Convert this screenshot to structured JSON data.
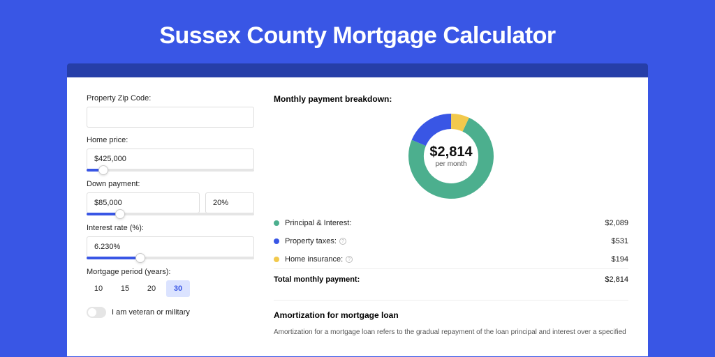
{
  "hero": {
    "title": "Sussex County Mortgage Calculator"
  },
  "form": {
    "zip": {
      "label": "Property Zip Code:",
      "value": ""
    },
    "home_price": {
      "label": "Home price:",
      "value": "$425,000",
      "slider_pct": 10
    },
    "down_payment": {
      "label": "Down payment:",
      "value": "$85,000",
      "pct": "20%",
      "slider_pct": 20
    },
    "interest": {
      "label": "Interest rate (%):",
      "value": "6.230%",
      "slider_pct": 32
    },
    "period": {
      "label": "Mortgage period (years):",
      "options": [
        "10",
        "15",
        "20",
        "30"
      ],
      "selected": "30"
    },
    "veteran": {
      "label": "I am veteran or military",
      "on": false
    }
  },
  "breakdown": {
    "title": "Monthly payment breakdown:",
    "center_value": "$2,814",
    "center_label": "per month",
    "items": [
      {
        "label": "Principal & Interest:",
        "value": "$2,089",
        "color": "#4caf8e",
        "info": false
      },
      {
        "label": "Property taxes:",
        "value": "$531",
        "color": "#3956e5",
        "info": true
      },
      {
        "label": "Home insurance:",
        "value": "$194",
        "color": "#f2c94c",
        "info": true
      }
    ],
    "total_label": "Total monthly payment:",
    "total_value": "$2,814"
  },
  "amort": {
    "title": "Amortization for mortgage loan",
    "text": "Amortization for a mortgage loan refers to the gradual repayment of the loan principal and interest over a specified"
  },
  "chart_data": {
    "type": "pie",
    "title": "Monthly payment breakdown",
    "series": [
      {
        "name": "Principal & Interest",
        "value": 2089,
        "color": "#4caf8e"
      },
      {
        "name": "Property taxes",
        "value": 531,
        "color": "#3956e5"
      },
      {
        "name": "Home insurance",
        "value": 194,
        "color": "#f2c94c"
      }
    ],
    "total": 2814,
    "center_text": "$2,814 per month"
  }
}
